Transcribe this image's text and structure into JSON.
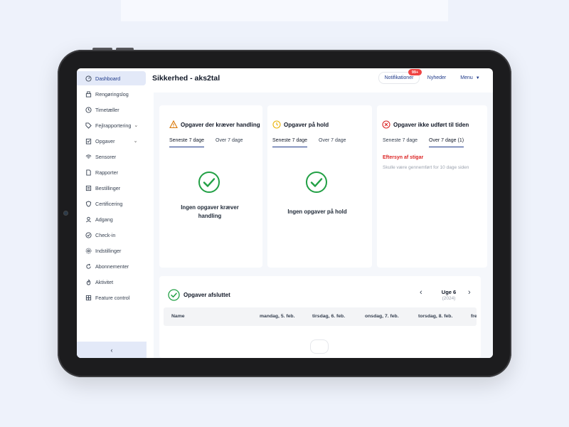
{
  "header": {
    "title": "Sikkerhed - aks2tal",
    "notifications_label": "Notifikationer",
    "notifications_badge": "99+",
    "news_label": "Nyheder",
    "menu_label": "Menu"
  },
  "sidebar": {
    "items": [
      {
        "label": "Dashboard",
        "icon": "dashboard-icon",
        "active": true
      },
      {
        "label": "Rengøringslog",
        "icon": "broom-icon"
      },
      {
        "label": "Timetæller",
        "icon": "clock-icon"
      },
      {
        "label": "Fejlrapportering",
        "icon": "tag-icon",
        "expandable": true
      },
      {
        "label": "Opgaver",
        "icon": "clipboard-icon",
        "expandable": true
      },
      {
        "label": "Sensorer",
        "icon": "wifi-icon"
      },
      {
        "label": "Rapporter",
        "icon": "document-icon"
      },
      {
        "label": "Bestillinger",
        "icon": "list-icon"
      },
      {
        "label": "Certificering",
        "icon": "shield-icon"
      },
      {
        "label": "Adgang",
        "icon": "user-icon"
      },
      {
        "label": "Check-in",
        "icon": "check-circle-icon"
      },
      {
        "label": "Indstillinger",
        "icon": "gear-icon"
      },
      {
        "label": "Abonnementer",
        "icon": "refresh-icon"
      },
      {
        "label": "Aktivitet",
        "icon": "flame-icon"
      },
      {
        "label": "Feature control",
        "icon": "grid-icon"
      }
    ],
    "collapse_label": "‹"
  },
  "cards": {
    "action_required": {
      "title": "Opgaver der kræver handling",
      "tabs": [
        "Seneste 7 dage",
        "Over 7 dage"
      ],
      "empty_text": "Ingen opgaver kræver handling"
    },
    "on_hold": {
      "title": "Opgaver på hold",
      "tabs": [
        "Seneste 7 dage",
        "Over 7 dage"
      ],
      "empty_text": "Ingen opgaver på hold"
    },
    "overdue": {
      "title": "Opgaver ikke udført til tiden",
      "tabs": [
        "Seneste 7 dage",
        "Over 7 dage (1)"
      ],
      "item_title": "Eftersyn af stigar",
      "item_subtitle": "Skulle være gennemført for 10 dage siden"
    }
  },
  "completed": {
    "title": "Opgaver afsluttet",
    "week_label": "Uge 6",
    "week_year": "(2024)",
    "columns": [
      "Name",
      "mandag, 5. feb.",
      "tirsdag, 6. feb.",
      "onsdag, 7. feb.",
      "torsdag, 8. feb.",
      "fre"
    ]
  },
  "colors": {
    "accent": "#1f3a8a",
    "success": "#22a045",
    "warning": "#d97706",
    "danger": "#dc2626"
  }
}
